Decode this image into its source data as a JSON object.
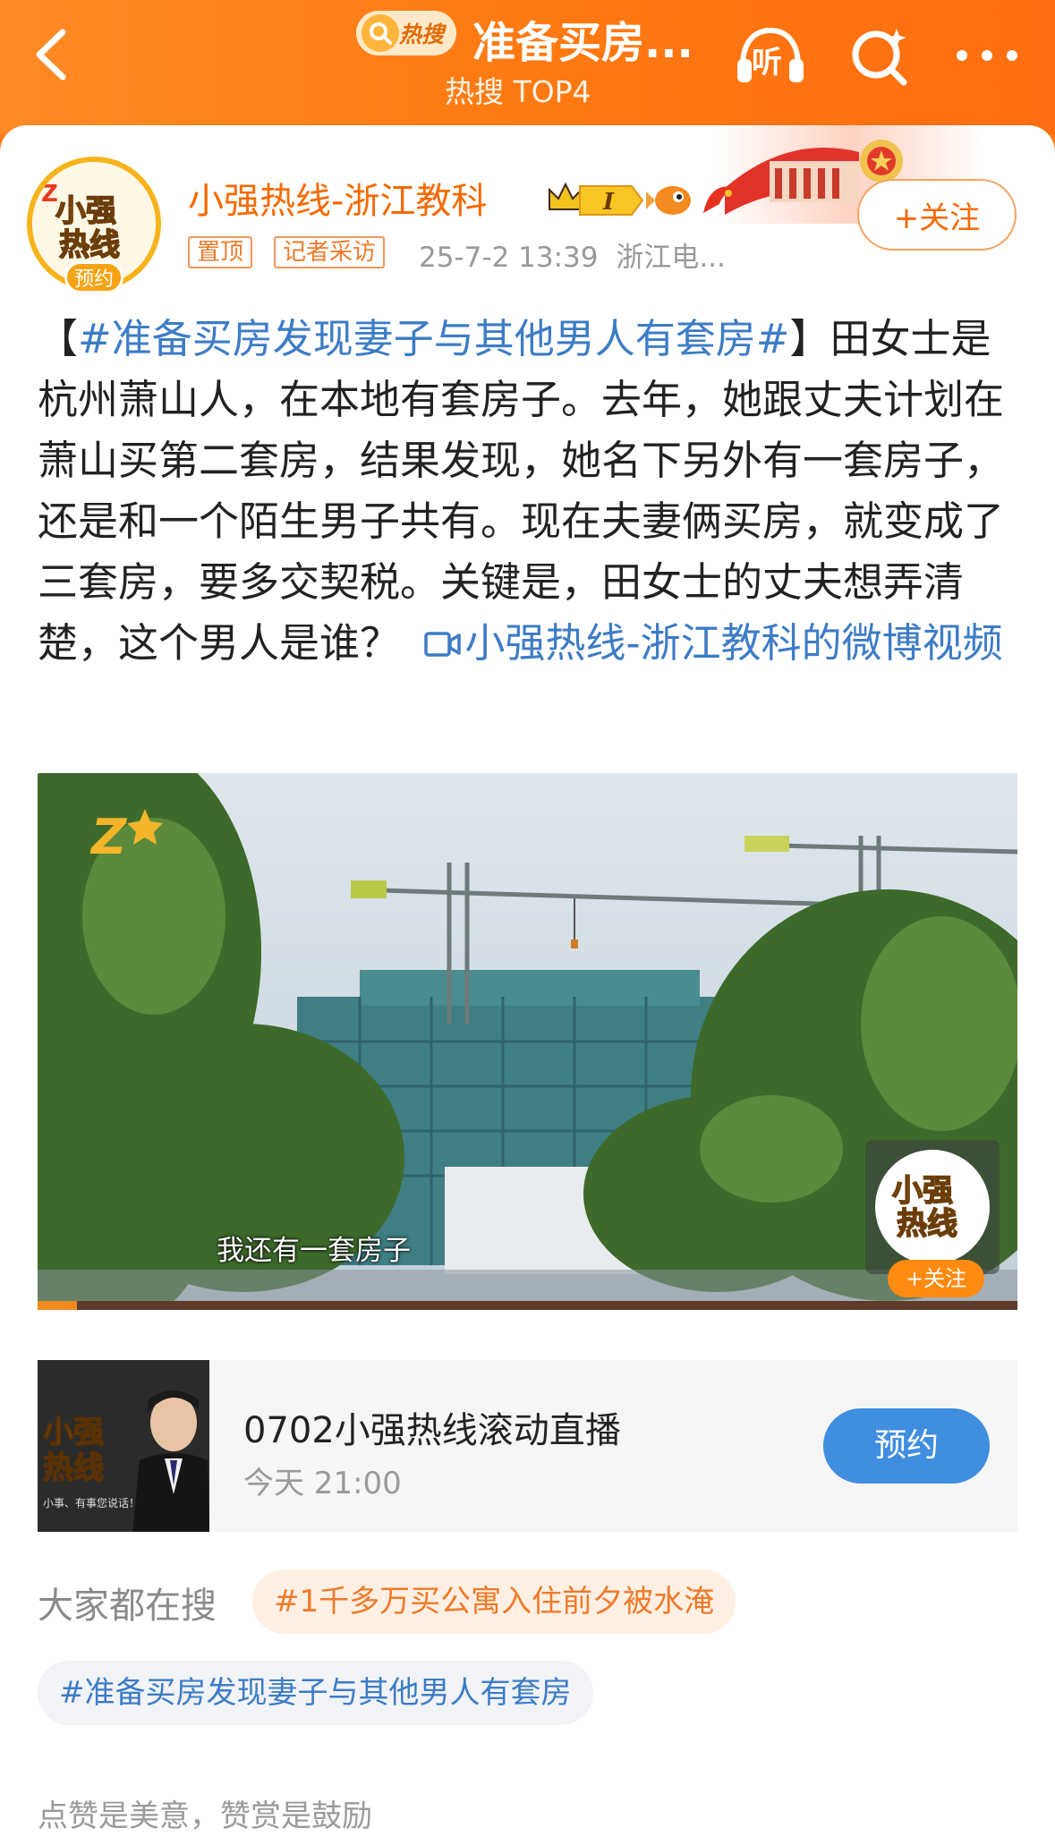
{
  "header": {
    "hot_label": "热搜",
    "title": "准备买房...",
    "subtitle": "热搜 TOP4",
    "listen_label": "听"
  },
  "user": {
    "name": "小强热线-浙江教科",
    "avatar_tag": "预约",
    "vip_level": "I",
    "follow_label": "+关注",
    "tags": [
      "置顶",
      "记者采访"
    ],
    "time": "25-7-2 13:39",
    "source": "浙江电..."
  },
  "post": {
    "bracket_open": "【",
    "topic": "#准备买房发现妻子与其他男人有套房#",
    "bracket_close": "】",
    "body": "田女士是杭州萧山人，在本地有套房子。去年，她跟丈夫计划在萧山买第二套房，结果发现，她名下另外有一套房子，还是和一个陌生男子共有。现在夫妻俩买房，就变成了三套房，要多交契税。关键是，田女士的丈夫想弄清楚，这个男人是谁？",
    "video_link": "小强热线-浙江教科的微博视频"
  },
  "video": {
    "caption": "我还有一套房子",
    "follow_label": "+关注",
    "progress": 0.04
  },
  "live": {
    "title": "0702小强热线滚动直播",
    "time": "今天 21:00",
    "reserve_label": "预约",
    "thumb_slogan": "小事、有事您说话！"
  },
  "search": {
    "label": "大家都在搜",
    "chips": [
      "#1千多万买公寓入住前夕被水淹",
      "#准备买房发现妻子与其他男人有套房"
    ]
  },
  "footer": {
    "encourage": "点赞是美意，赞赏是鼓励"
  },
  "colors": {
    "brand_orange": "#ff7a12",
    "link_blue": "#3d7cc6",
    "reserve_blue": "#3f8ee0"
  }
}
